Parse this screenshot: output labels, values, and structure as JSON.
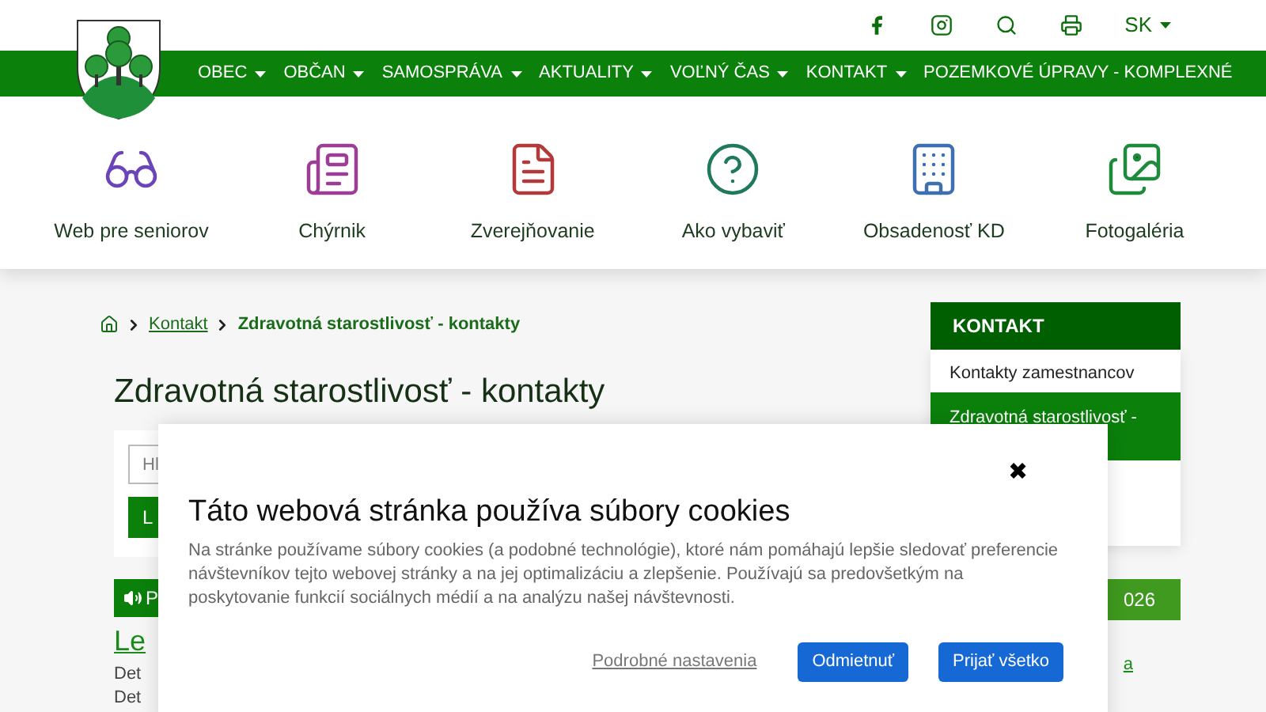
{
  "top_bar": {
    "language": "SK"
  },
  "nav": [
    {
      "label": "OBEC"
    },
    {
      "label": "OBČAN"
    },
    {
      "label": "SAMOSPRÁVA"
    },
    {
      "label": "AKTUALITY"
    },
    {
      "label": "VOĽNÝ ČAS"
    },
    {
      "label": "KONTAKT"
    },
    {
      "label": "POZEMKOVÉ ÚPRAVY - KOMPLEXNÉ",
      "kind": "plain"
    }
  ],
  "quick_links": [
    {
      "label": "Web pre seniorov",
      "kind": "glasses",
      "color": "#6b45b8"
    },
    {
      "label": "Chýrnik",
      "kind": "newspaper",
      "color": "#9c3d96"
    },
    {
      "label": "Zverejňovanie",
      "kind": "document",
      "color": "#b23a3a"
    },
    {
      "label": "Ako vybaviť",
      "kind": "help",
      "color": "#1f7a5c"
    },
    {
      "label": "Obsadenosť KD",
      "kind": "building",
      "color": "#3e6fae"
    },
    {
      "label": "Fotogaléria",
      "kind": "gallery",
      "color": "#1e8a3c"
    }
  ],
  "breadcrumb": [
    {
      "label": "Kontakt",
      "kind": "link"
    },
    {
      "label": "Zdravotná starostlivosť - kontakty",
      "kind": "current"
    }
  ],
  "page_title": "Zdravotná starostlivosť - kontakty",
  "search": {
    "placeholder": "Hl",
    "button": "L"
  },
  "audio_bar": "P",
  "article": {
    "title": "Le",
    "lines": [
      "Det",
      "Det"
    ]
  },
  "sidebar": {
    "title": "KONTAKT",
    "items": [
      {
        "label": "Kontakty zamestnancov",
        "selected": false
      },
      {
        "label": "Zdravotná starostlivosť -",
        "selected": true
      }
    ]
  },
  "side_box": {
    "title": "026",
    "links": [
      "a"
    ]
  },
  "cookie_dialog": {
    "close": "✖",
    "title": "Táto webová stránka používa súbory cookies",
    "text": "Na stránke používame súbory cookies (a podobné technológie), ktoré nám pomáhajú lepšie sledovať preferencie návštevníkov tejto webovej stránky a na jej optimalizáciu a zlepšenie. Používajú sa predovšetkým na poskytovanie funkcií sociálnych médií a na analýzu našej návštevnosti.",
    "settings_link": "Podrobné nastavenia",
    "buttons": [
      "Odmietnuť",
      "Prijať všetko"
    ]
  }
}
